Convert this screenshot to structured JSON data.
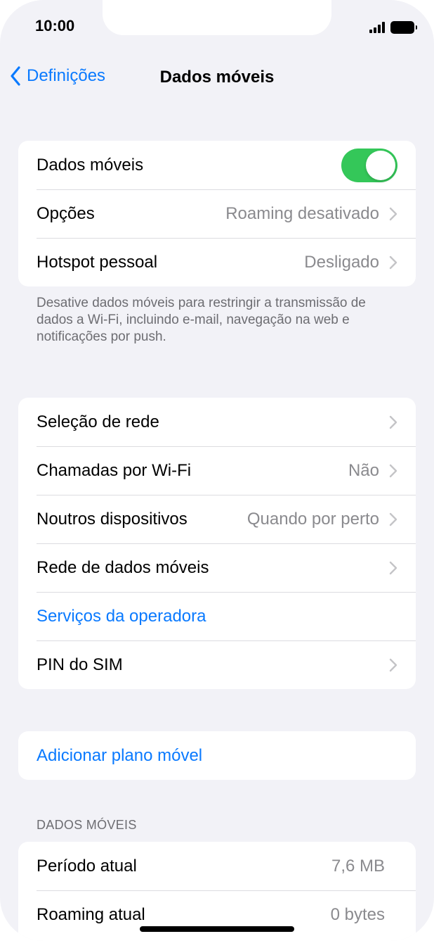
{
  "status_bar": {
    "time": "10:00"
  },
  "nav": {
    "back_label": "Definições",
    "title": "Dados móveis"
  },
  "group1": {
    "rows": [
      {
        "label": "Dados móveis",
        "toggle_on": true
      },
      {
        "label": "Opções",
        "value": "Roaming desativado"
      },
      {
        "label": "Hotspot pessoal",
        "value": "Desligado"
      }
    ],
    "footnote": "Desative dados móveis para restringir a transmissão de dados a Wi-Fi, incluindo e-mail, navegação na web e notificações por push."
  },
  "group2": {
    "rows": [
      {
        "label": "Seleção de rede",
        "value": ""
      },
      {
        "label": "Chamadas por Wi-Fi",
        "value": "Não"
      },
      {
        "label": "Noutros dispositivos",
        "value": "Quando por perto"
      },
      {
        "label": "Rede de dados móveis",
        "value": ""
      },
      {
        "label": "Serviços da operadora"
      },
      {
        "label": "PIN do SIM",
        "value": ""
      }
    ]
  },
  "group3": {
    "add_plan_label": "Adicionar plano móvel"
  },
  "usage": {
    "header": "DADOS MÓVEIS",
    "rows": [
      {
        "label": "Período atual",
        "value": "7,6 MB"
      },
      {
        "label": "Roaming atual",
        "value": "0 bytes"
      }
    ]
  },
  "colors": {
    "accent": "#0a7aff",
    "toggle_on": "#34c759",
    "background": "#f2f2f7"
  }
}
